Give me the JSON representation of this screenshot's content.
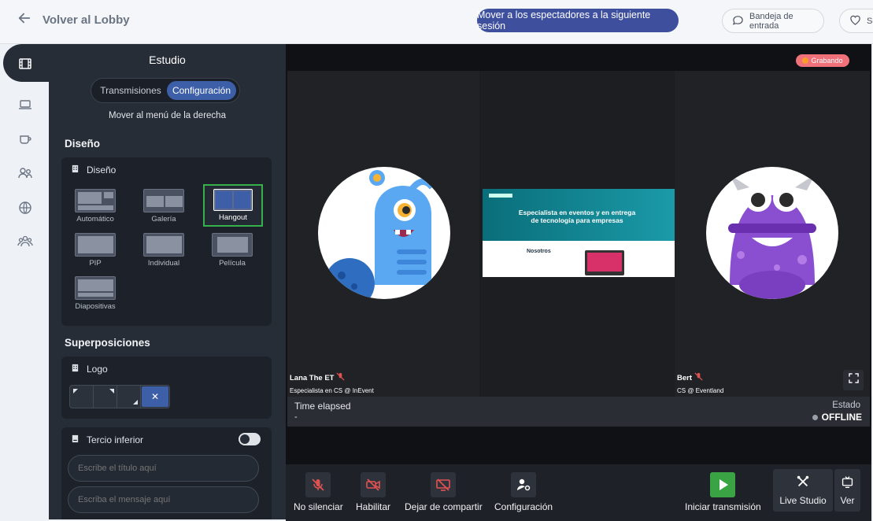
{
  "topbar": {
    "back_label": "Volver al Lobby",
    "move_button": "Mover a los espectadores a la siguiente sesión",
    "inbox_label": "Bandeja de entrada",
    "partial_label": "Sc"
  },
  "rail": {
    "items": [
      "film-icon",
      "laptop-icon",
      "coffee-icon",
      "people-icon",
      "globe-icon",
      "group-icon"
    ]
  },
  "studio": {
    "title": "Estudio",
    "tabs": [
      "Transmisiones",
      "Configuración"
    ],
    "active_tab": "Configuración",
    "move_menu": "Mover al menú de la derecha",
    "design_section": "Diseño",
    "design_card_title": "Diseño",
    "layouts": [
      "Automático",
      "Galería",
      "Hangout",
      "PIP",
      "Individual",
      "Película",
      "Diapositivas"
    ],
    "selected_layout": "Hangout",
    "overlays_section": "Superposiciones",
    "logo_card_title": "Logo",
    "logo_remove": "✕",
    "lower_third_title": "Tercio inferior",
    "title_placeholder": "Escribe el título aquí",
    "message_placeholder": "Escriba el mensaje aquí"
  },
  "stage": {
    "recording_badge": "Grabando",
    "participants": [
      {
        "name": "Lana The ET",
        "role": "Especialista en CS @ InEvent"
      },
      {
        "name": "Bert",
        "role": "CS @ Eventland"
      }
    ],
    "screen_share": {
      "heading": "Especialista en eventos y en entrega de tecnología para empresas",
      "section": "Nosotros"
    },
    "time_elapsed_label": "Time elapsed",
    "time_elapsed_value": "-",
    "estado_label": "Estado",
    "estado_value": "OFFLINE"
  },
  "controls": {
    "unmute": "No silenciar",
    "enable": "Habilitar",
    "stop_share": "Dejar de compartir",
    "settings": "Configuración",
    "start": "Iniciar transmisión",
    "live_studio": "Live Studio",
    "view": "Ver"
  },
  "colors": {
    "primary": "#3e4f9e",
    "panel": "#272d36",
    "recording": "#f0717a",
    "selected_border": "#36b04a",
    "start_green": "#3aa343"
  }
}
